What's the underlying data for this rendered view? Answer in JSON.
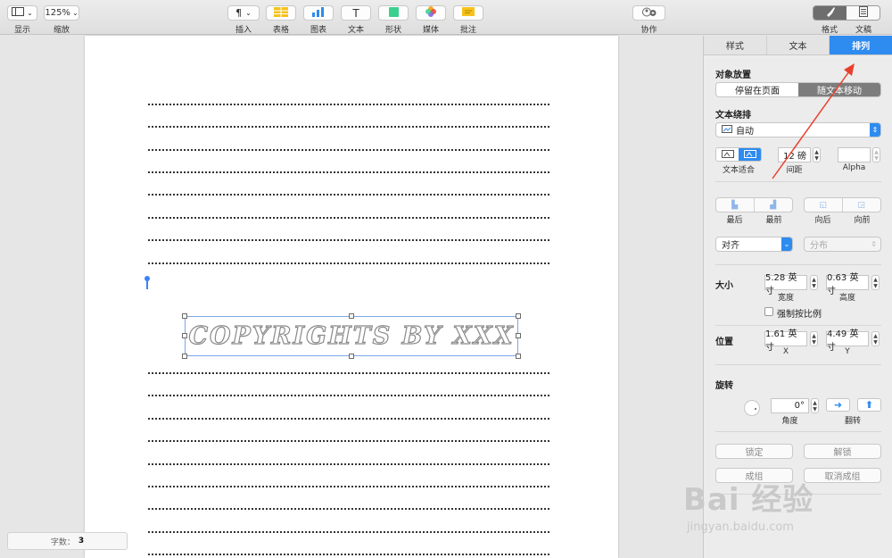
{
  "toolbar": {
    "view": {
      "label": "显示"
    },
    "zoom": {
      "value": "125%",
      "label": "缩放"
    },
    "insert": {
      "icon": "¶",
      "label": "插入"
    },
    "table": {
      "label": "表格"
    },
    "chart": {
      "label": "图表"
    },
    "text": {
      "icon": "T",
      "label": "文本"
    },
    "shape": {
      "label": "形状"
    },
    "media": {
      "label": "媒体"
    },
    "comment": {
      "label": "批注"
    },
    "collaborate": {
      "label": "协作"
    },
    "format": {
      "label": "格式"
    },
    "document": {
      "label": "文稿"
    }
  },
  "document": {
    "wordart": "COPYRIGHTS BY XXX",
    "word_count_label": "字数：",
    "word_count": "3"
  },
  "inspector": {
    "tabs": [
      "样式",
      "文本",
      "排列"
    ],
    "active_tab": "排列",
    "object_placement": {
      "title": "对象放置",
      "options": [
        "停留在页面",
        "随文本移动"
      ],
      "selected": "随文本移动"
    },
    "text_wrap": {
      "title": "文本绕排",
      "value": "自动",
      "fit_label": "文本适合",
      "spacing_value": "12 磅",
      "spacing_label": "间距",
      "alpha_label": "Alpha"
    },
    "layering": [
      "最后",
      "最前",
      "向后",
      "向前"
    ],
    "align": {
      "value": "对齐",
      "distribute": "分布"
    },
    "size": {
      "title": "大小",
      "width": "5.28 英寸",
      "width_label": "宽度",
      "height": "0.63 英寸",
      "height_label": "高度",
      "constrain": "强制按比例"
    },
    "position": {
      "title": "位置",
      "x": "1.61 英寸",
      "x_label": "X",
      "y": "4.49 英寸",
      "y_label": "Y"
    },
    "rotate": {
      "title": "旋转",
      "angle": "0°",
      "angle_label": "角度",
      "flip_label": "翻转"
    },
    "buttons": {
      "lock": "锁定",
      "unlock": "解锁",
      "group": "成组",
      "ungroup": "取消成组"
    }
  },
  "watermark": {
    "main": "Bai 经验",
    "sub": "jingyan.baidu.com"
  },
  "colors": {
    "accent": "#2e8bf0",
    "annotation_arrow": "#e8402f"
  }
}
